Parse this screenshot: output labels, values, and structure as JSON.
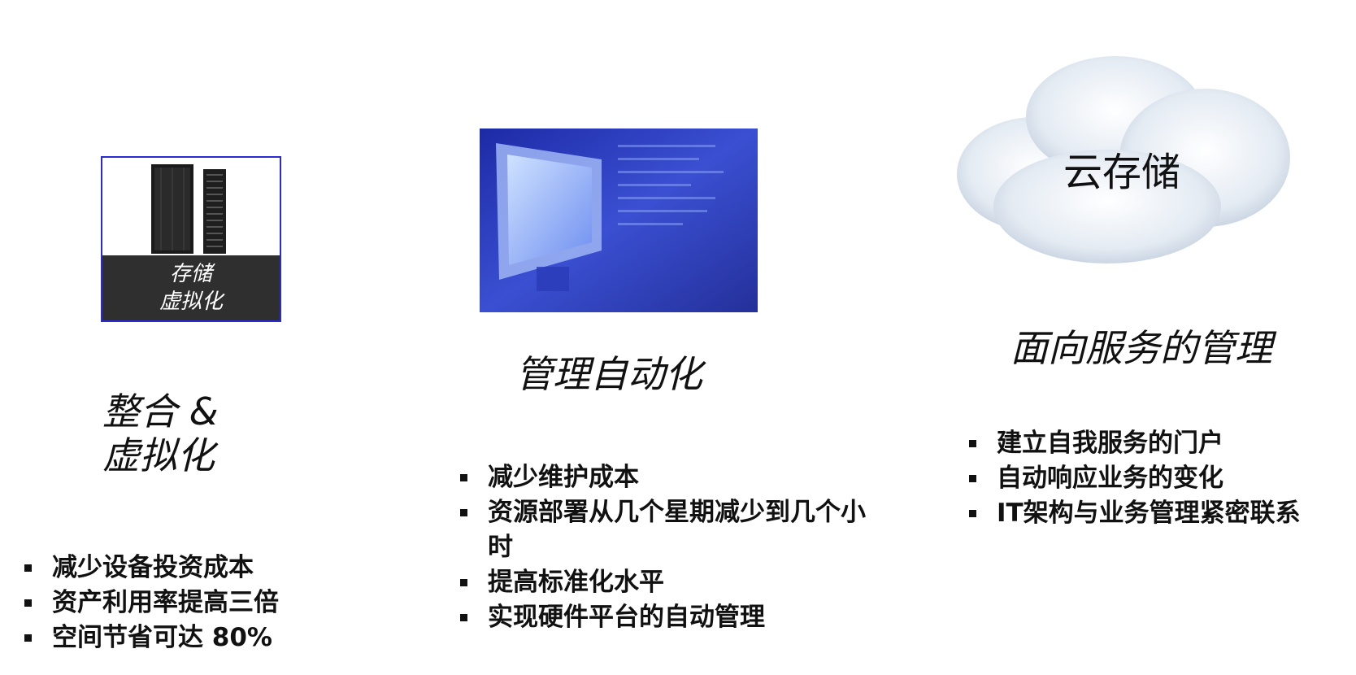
{
  "column1": {
    "tile_caption_line1": "存储",
    "tile_caption_line2": "虚拟化",
    "heading_line1": "整合 &",
    "heading_line2": "虚拟化",
    "bullets": [
      "减少设备投资成本",
      "资产利用率提高三倍",
      "空间节省可达 80%"
    ]
  },
  "column2": {
    "heading": "管理自动化",
    "bullets": [
      "减少维护成本",
      "资源部署从几个星期减少到几个小时",
      "提高标准化水平",
      "实现硬件平台的自动管理"
    ]
  },
  "column3": {
    "cloud_label": "云存储",
    "heading": "面向服务的管理",
    "bullets": [
      "建立自我服务的门户",
      "自动响应业务的变化",
      "IT架构与业务管理紧密联系"
    ]
  },
  "colors": {
    "tile_border": "#2b2bd6",
    "tile_caption_bg": "#2f2f2f",
    "monitor_bg": "#2f3fc0",
    "cloud_fill": "#dfe7f0"
  },
  "icons": [
    "storage-rack-icon",
    "monitor-icon",
    "cloud-icon"
  ]
}
